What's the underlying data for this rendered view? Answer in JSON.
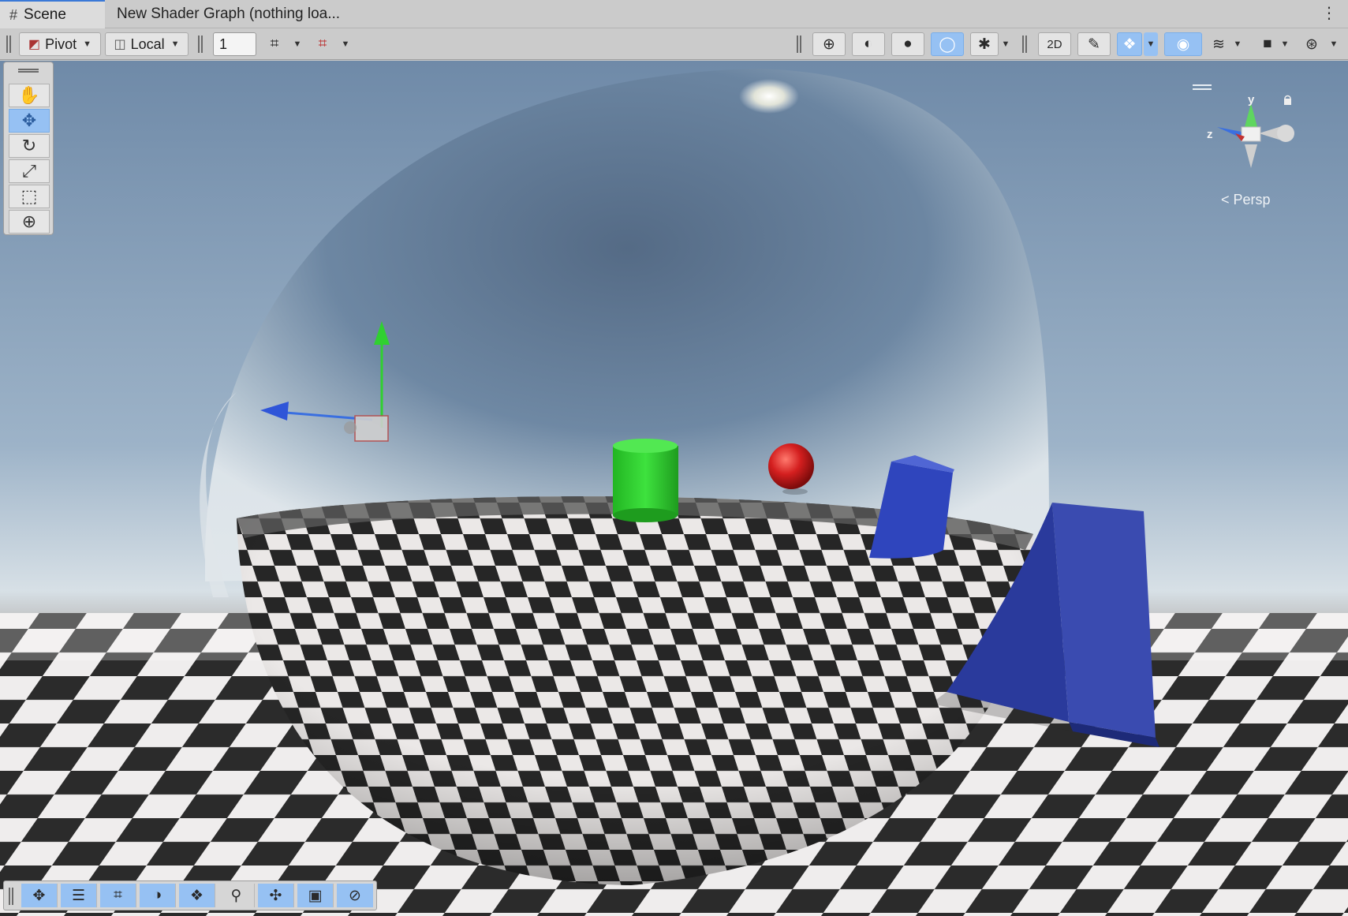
{
  "tabs": [
    {
      "label": "Scene",
      "icon": "grid-icon",
      "active": true
    },
    {
      "label": "New Shader Graph (nothing loa...",
      "active": false
    }
  ],
  "toolbar": {
    "pivot_label": "Pivot",
    "local_label": "Local",
    "grid_value": "1"
  },
  "gizmo": {
    "y_label": "y",
    "z_label": "z",
    "projection_label": "Persp"
  },
  "colors": {
    "accent": "#96c1f3",
    "sky_top": "#7d97b3",
    "floor_dark": "#2a2a2a",
    "floor_light": "#efeded",
    "cylinder": "#2ecc2e",
    "sphere": "#d11e1e",
    "blue_objects": "#3349b7"
  },
  "icons": {
    "tool_palette": [
      "hand-icon",
      "move-icon",
      "rotate-icon",
      "scale-icon",
      "rect-icon",
      "transform-icon"
    ],
    "bottom_bar": [
      "move-icon",
      "sliders-icon",
      "grid-icon",
      "shading-icon",
      "layers-icon",
      "search-icon",
      "pivot-icon",
      "camera-icon",
      "compass-icon"
    ]
  }
}
